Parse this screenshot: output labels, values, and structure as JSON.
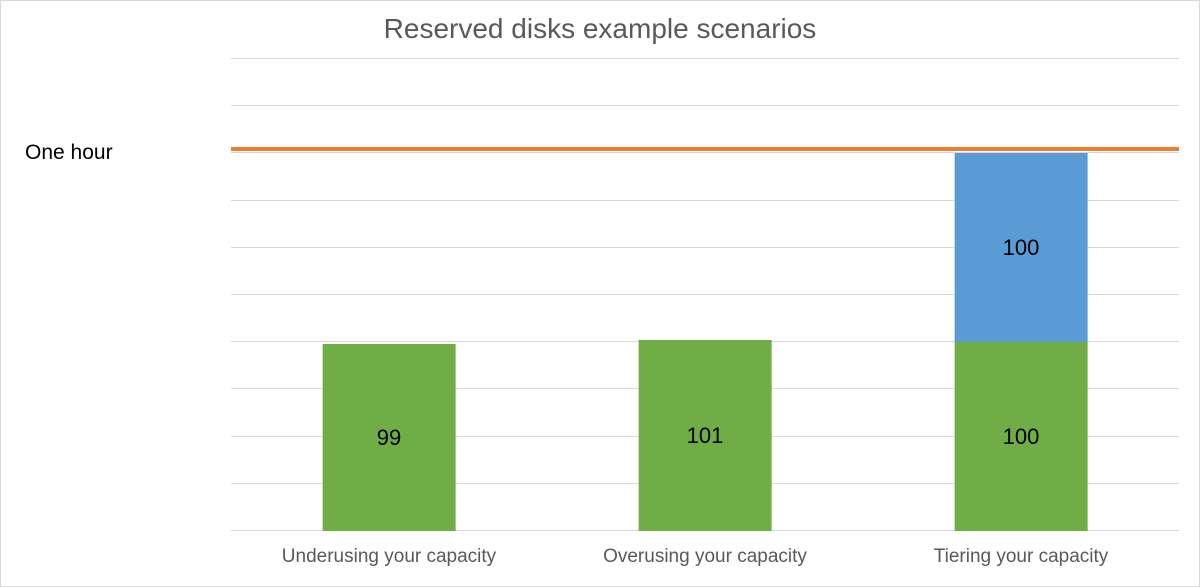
{
  "chart_data": {
    "type": "bar",
    "title": "Reserved disks example scenarios",
    "categories": [
      "Underusing your capacity",
      "Overusing your capacity",
      "Tiering your capacity"
    ],
    "series": [
      {
        "name": "green",
        "values": [
          99,
          101,
          100
        ]
      },
      {
        "name": "blue",
        "values": [
          0,
          0,
          100
        ]
      }
    ],
    "stacked_totals": [
      99,
      101,
      200
    ],
    "ylim": [
      0,
      250
    ],
    "grid_step": 25,
    "reference_line": {
      "label": "One hour",
      "value": 200
    },
    "xlabel": "",
    "ylabel": ""
  },
  "colors": {
    "green": "#70AD47",
    "blue": "#5B9BD5",
    "ref": "#ED7D31",
    "grid": "#d9d9d9",
    "text_muted": "#595959"
  }
}
